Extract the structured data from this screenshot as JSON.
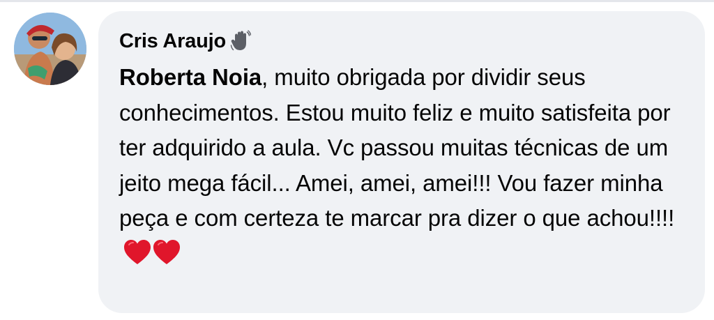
{
  "comment": {
    "author": "Cris Araujo",
    "author_badge_icon": "waving-hand-icon",
    "mention": "Roberta Noia",
    "text": ", muito obrigada por dividir seus conhecimentos. Estou muito feliz e muito satisfeita por ter adquirido a aula. Vc passou muitas técnicas de um jeito mega fácil... Amei, amei, amei!!! Vou fazer minha peça e com certeza te marcar pra dizer o que achou!!!!",
    "emojis": [
      "red-heart-icon",
      "red-heart-icon"
    ]
  },
  "colors": {
    "bubble_background": "#f0f2f5",
    "text": "#050505",
    "heart": "#e0162b"
  }
}
